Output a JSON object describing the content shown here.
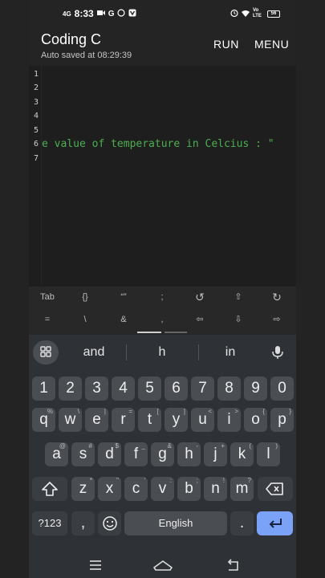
{
  "status_bar": {
    "network": "4G",
    "time": "8:33",
    "left_icons": [
      "video-call-icon",
      "google-icon",
      "whatsapp-icon",
      "vpn-icon"
    ],
    "right_labels": [
      "Vo LTE",
      "56"
    ],
    "right_icons": [
      "alarm-icon",
      "wifi-icon",
      "battery-icon"
    ]
  },
  "app_bar": {
    "title": "Coding C",
    "subtitle": "Auto saved at 08:29:39",
    "run_label": "RUN",
    "menu_label": "MENU"
  },
  "editor": {
    "lines": [
      {
        "num": "1",
        "code": ""
      },
      {
        "num": "2",
        "code": ""
      },
      {
        "num": "3",
        "code": ""
      },
      {
        "num": "4",
        "code": ""
      },
      {
        "num": "5",
        "code": ""
      },
      {
        "num": "6",
        "code": "e value of temperature in Celcius : \""
      },
      {
        "num": "7",
        "code": ""
      }
    ],
    "code_color": "#4caf50"
  },
  "extra_keys": {
    "row1": [
      "Tab",
      "{}",
      "“”",
      ";",
      "↺",
      "⇧",
      "↻"
    ],
    "row2": [
      "=",
      "\\",
      "&",
      ",",
      "⇦",
      "⇩",
      "⇨"
    ]
  },
  "keyboard": {
    "suggestions": [
      "and",
      "h",
      "in"
    ],
    "number_row": [
      "1",
      "2",
      "3",
      "4",
      "5",
      "6",
      "7",
      "8",
      "9",
      "0"
    ],
    "row_q": [
      {
        "k": "q",
        "h": "%"
      },
      {
        "k": "w",
        "h": "\\"
      },
      {
        "k": "e",
        "h": "|"
      },
      {
        "k": "r",
        "h": "="
      },
      {
        "k": "t",
        "h": "["
      },
      {
        "k": "y",
        "h": "]"
      },
      {
        "k": "u",
        "h": "<"
      },
      {
        "k": "i",
        "h": ">"
      },
      {
        "k": "o",
        "h": "{"
      },
      {
        "k": "p",
        "h": "}"
      }
    ],
    "row_a": [
      {
        "k": "a",
        "h": "@"
      },
      {
        "k": "s",
        "h": "#"
      },
      {
        "k": "d",
        "h": "$"
      },
      {
        "k": "f",
        "h": "_"
      },
      {
        "k": "g",
        "h": "&"
      },
      {
        "k": "h",
        "h": "-"
      },
      {
        "k": "j",
        "h": "+"
      },
      {
        "k": "k",
        "h": "("
      },
      {
        "k": "l",
        "h": ")"
      }
    ],
    "row_z": [
      {
        "k": "z",
        "h": "*"
      },
      {
        "k": "x",
        "h": "\""
      },
      {
        "k": "c",
        "h": "'"
      },
      {
        "k": "v",
        "h": ":"
      },
      {
        "k": "b",
        "h": ";"
      },
      {
        "k": "n",
        "h": "!"
      },
      {
        "k": "m",
        "h": "?"
      }
    ],
    "symbols_label": "?123",
    "comma": ",",
    "space_label": "English",
    "period": ".",
    "accent_color": "#7aa2f7"
  }
}
